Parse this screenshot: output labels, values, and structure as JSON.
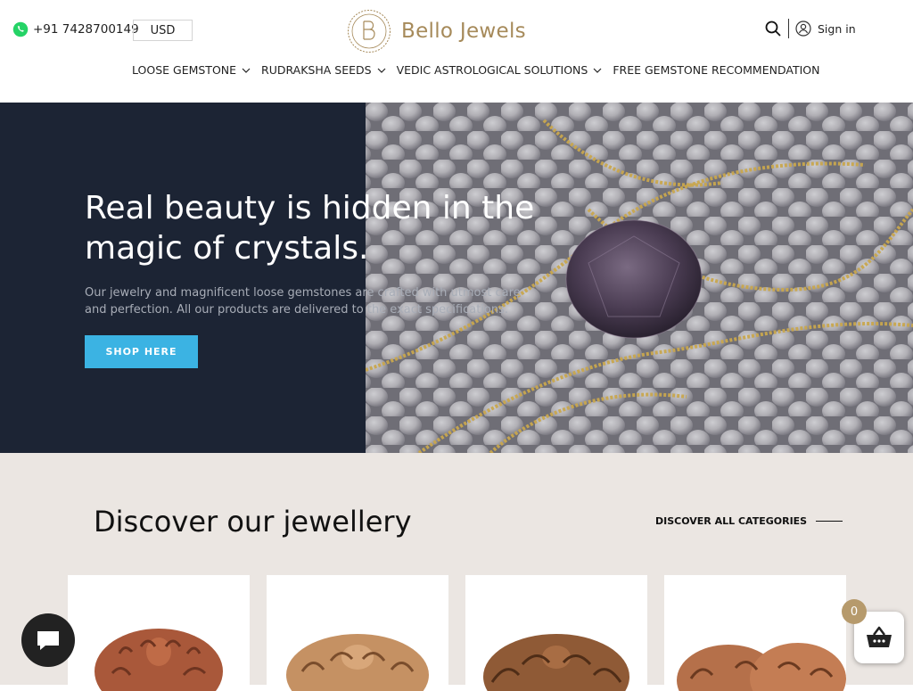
{
  "header": {
    "phone": "+91 7428700149",
    "currency": "USD",
    "brand": "Bello Jewels",
    "signin_label": "Sign in",
    "nav": [
      {
        "label": "LOOSE GEMSTONE"
      },
      {
        "label": "RUDRAKSHA SEEDS"
      },
      {
        "label": "VEDIC ASTROLOGICAL SOLUTIONS"
      },
      {
        "label": "FREE GEMSTONE RECOMMENDATION"
      }
    ]
  },
  "hero": {
    "title": "Real beauty is hidden in the magic of crystals.",
    "subtitle": "Our jewelry and magnificent loose gemstones are crafted with utmost care and perfection. All our products are delivered to the exact specifications.",
    "button_label": "SHOP HERE"
  },
  "discover": {
    "title": "Discover our jewellery",
    "link_label": "DISCOVER ALL CATEGORIES"
  },
  "cart": {
    "count": "0"
  },
  "colors": {
    "accent": "#3bb3e3",
    "brand_gold": "#a68a5a",
    "hero_bg": "#1c2434",
    "section_bg": "#ebe6e2"
  }
}
